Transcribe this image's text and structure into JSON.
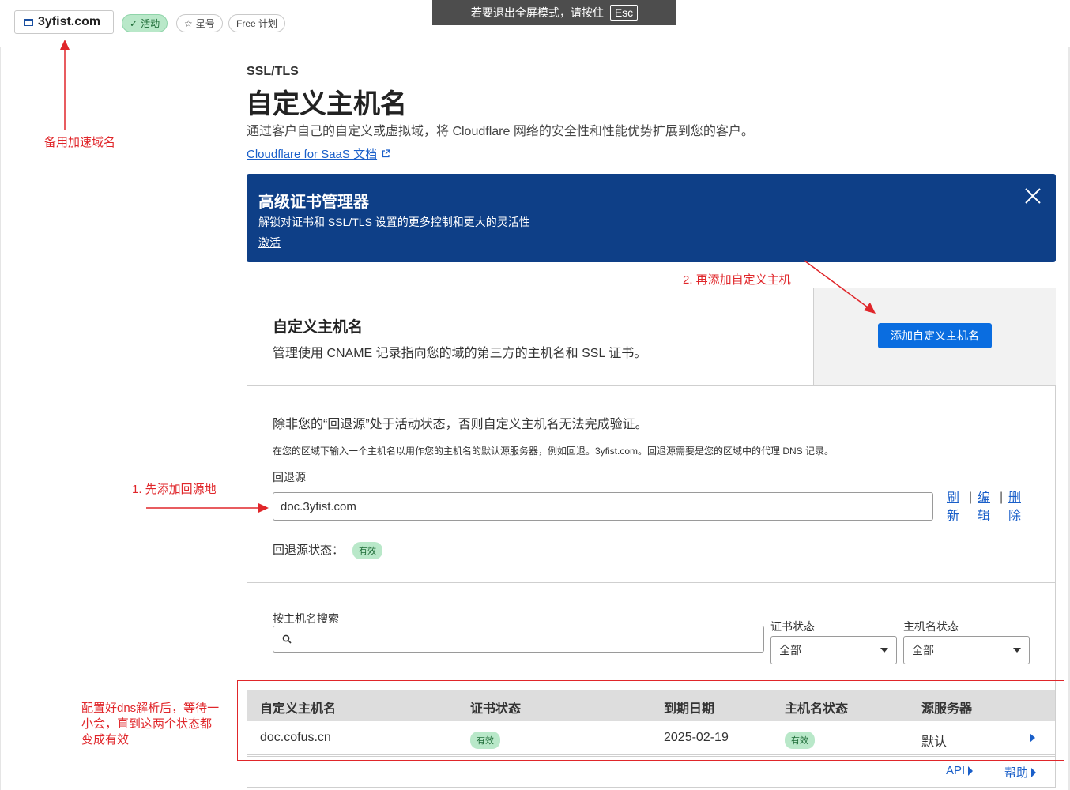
{
  "topbar": {
    "domain": "3yfist.com",
    "status_pill": "活动",
    "star_pill": "星号",
    "plan_pill": "Free 计划",
    "fullscreen_hint": "若要退出全屏模式，请按住",
    "esc_key": "Esc"
  },
  "header": {
    "breadcrumb": "SSL/TLS",
    "title": "自定义主机名",
    "description": "通过客户自己的自定义或虚拟域，将 Cloudflare 网络的安全性和性能优势扩展到您的客户。",
    "docs_link": "Cloudflare for SaaS 文档"
  },
  "banner": {
    "title": "高级证书管理器",
    "description": "解锁对证书和 SSL/TLS 设置的更多控制和更大的灵活性",
    "link": "激活"
  },
  "card": {
    "title": "自定义主机名",
    "description": "管理使用 CNAME 记录指向您的域的第三方的主机名和 SSL 证书。",
    "add_button": "添加自定义主机名"
  },
  "fallback": {
    "heading": "除非您的“回退源”处于活动状态，否则自定义主机名无法完成验证。",
    "note": "在您的区域下输入一个主机名以用作您的主机名的默认源服务器，例如回退。3yfist.com。回退源需要是您的区域中的代理 DNS 记录。",
    "label": "回退源",
    "value": "doc.3yfist.com",
    "actions": {
      "refresh_1": "刷",
      "refresh_2": "新",
      "edit_1": "编",
      "edit_2": "辑",
      "delete_1": "删",
      "delete_2": "除"
    },
    "status_label": "回退源状态：",
    "status_badge": "有效"
  },
  "filters": {
    "search_label": "按主机名搜索",
    "search_placeholder": "",
    "cert_status_label": "证书状态",
    "cert_status_value": "全部",
    "host_status_label": "主机名状态",
    "host_status_value": "全部"
  },
  "table": {
    "columns": [
      "自定义主机名",
      "证书状态",
      "到期日期",
      "主机名状态",
      "源服务器"
    ],
    "rows": [
      {
        "hostname": "doc.cofus.cn",
        "cert_status": "有效",
        "expiry": "2025-02-19",
        "host_status": "有效",
        "origin": "默认"
      }
    ]
  },
  "footer": {
    "api_link": "API",
    "help_link": "帮助"
  },
  "annotations": {
    "backup_domain": "备用加速域名",
    "step2": "2. 再添加自定义主机",
    "step1": "1. 先添加回源地",
    "note_line1": "配置好dns解析后，等待一",
    "note_line2": "小会，直到这两个状态都",
    "note_line3": "变成有效"
  },
  "colors": {
    "accent_blue": "#0a6de0",
    "banner_navy": "#0e3f87",
    "valid_green_bg": "#b9e8c9",
    "annotation_red": "#e0262a"
  }
}
